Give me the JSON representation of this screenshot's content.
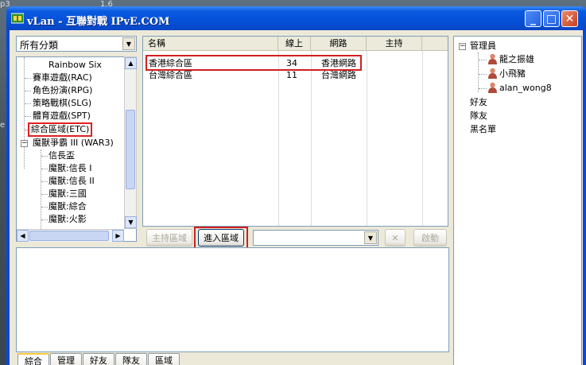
{
  "desktop": {
    "corner_left": "p3",
    "corner_top": "1.6",
    "edge": "e"
  },
  "window": {
    "title": "vLan - 互聯對戰 IPvE.COM",
    "min_label": "_",
    "max_label": "□",
    "close_label": "✕"
  },
  "category": {
    "selected": "所有分類",
    "tree": [
      {
        "label": "Rainbow Six"
      },
      {
        "label": "賽車遊戲(RAC)"
      },
      {
        "label": "角色扮演(RPG)"
      },
      {
        "label": "策略戰棋(SLG)"
      },
      {
        "label": "體育遊戲(SPT)"
      },
      {
        "label": "綜合區域(ETC)"
      },
      {
        "label": "魔獸爭霸 III (WAR3)"
      },
      {
        "label": "信長盃"
      },
      {
        "label": "魔獸:信長 I"
      },
      {
        "label": "魔獸:信長 II"
      },
      {
        "label": "魔獸:三國"
      },
      {
        "label": "魔獸:綜合"
      },
      {
        "label": "魔獸:火影"
      }
    ],
    "expander_war3": "−"
  },
  "rooms": {
    "columns": [
      "名稱",
      "線上",
      "網路",
      "主持"
    ],
    "rows": [
      {
        "name": "香港綜合區",
        "online": "34",
        "network": "香港網路",
        "host": ""
      },
      {
        "name": "台灣綜合區",
        "online": "11",
        "network": "台灣網路",
        "host": ""
      }
    ]
  },
  "actions": {
    "host_label": "主持區域",
    "enter_label": "進入區域",
    "combo_value": "",
    "x_label": "✕",
    "start_label": "啟動"
  },
  "tabs": [
    "綜合",
    "管理",
    "好友",
    "隊友",
    "區域"
  ],
  "users": {
    "admins_label": "管理員",
    "admins": [
      "龍之振雄",
      "小飛豬",
      "alan_wong8"
    ],
    "friends_label": "好友",
    "team_label": "隊友",
    "blacklist_label": "黑名單",
    "expander": "−"
  },
  "colors": {
    "title_blue": "#0450d8",
    "highlight_red": "#d02020",
    "window_bg": "#ece9d8"
  }
}
